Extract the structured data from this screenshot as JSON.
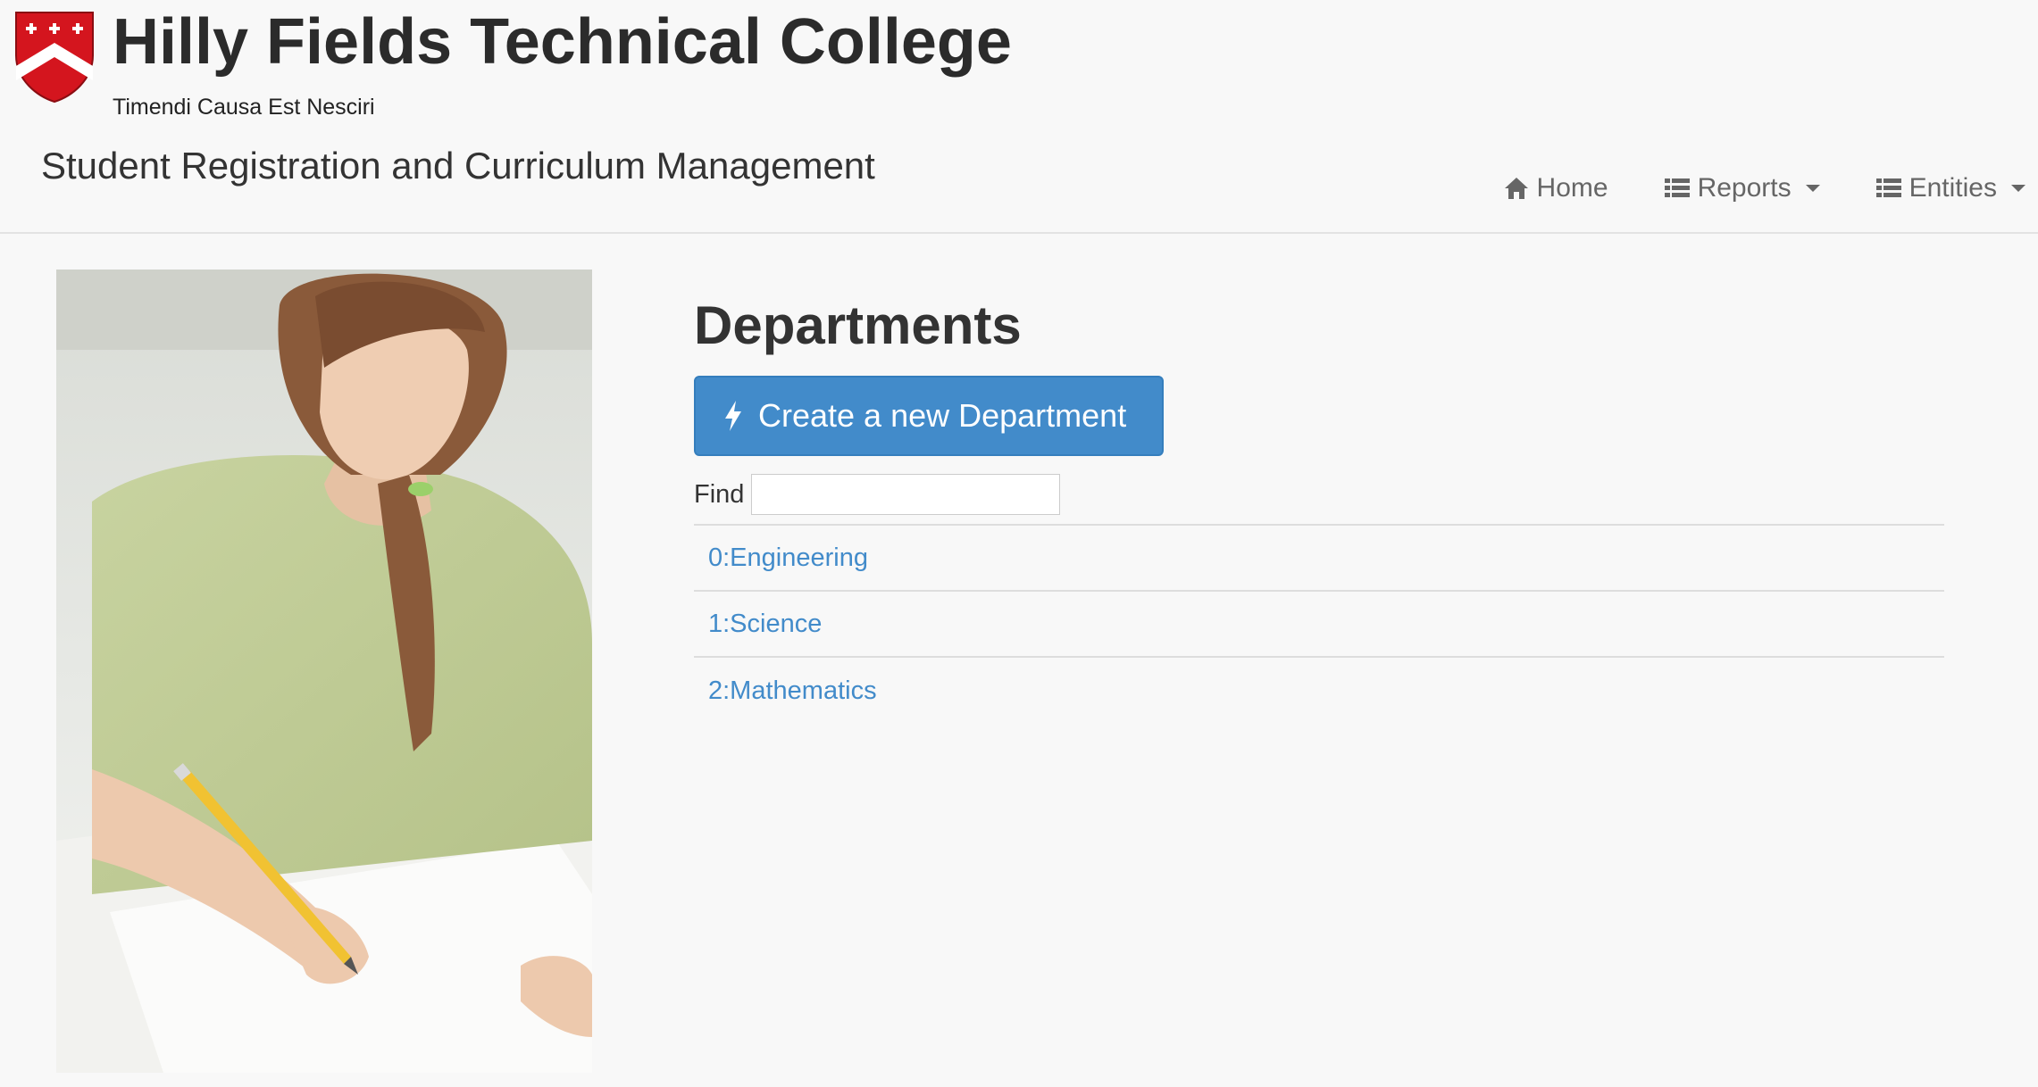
{
  "header": {
    "college_name": "Hilly Fields Technical College",
    "motto": "Timendi Causa Est Nesciri",
    "system_title": "Student Registration and Curriculum Management",
    "crest_icon": "shield-crest-icon",
    "crest_colors": {
      "red": "#d4151e",
      "white": "#ffffff"
    }
  },
  "nav": {
    "items": [
      {
        "label": "Home",
        "icon": "home-icon",
        "dropdown": false
      },
      {
        "label": "Reports",
        "icon": "list-icon",
        "dropdown": true
      },
      {
        "label": "Entities",
        "icon": "list-icon",
        "dropdown": true
      }
    ]
  },
  "main": {
    "title": "Departments",
    "create_button_label": "Create a new Department",
    "create_button_icon": "bolt-icon",
    "find_label": "Find",
    "find_value": "",
    "departments": [
      {
        "label": "0:Engineering"
      },
      {
        "label": "1:Science"
      },
      {
        "label": "2:Mathematics"
      }
    ]
  },
  "colors": {
    "primary": "#428bca",
    "link": "#428bca",
    "background": "#f8f8f8",
    "text": "#333333"
  }
}
